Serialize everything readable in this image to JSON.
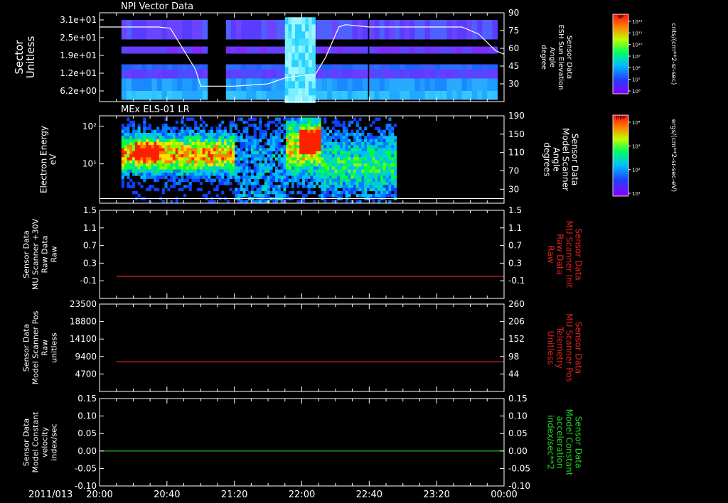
{
  "colors": {
    "background": "#000000",
    "frame": "#ffffff",
    "text": "#ffffff",
    "red_line": "#e02020",
    "green_line": "#22d322",
    "white_line": "#ffffff"
  },
  "x_axis": {
    "start_label": "2011/013",
    "tick_labels": [
      "20:00",
      "20:40",
      "21:20",
      "22:00",
      "22:40",
      "23:20",
      "00:00"
    ],
    "minutes": [
      0,
      40,
      80,
      120,
      160,
      200,
      240
    ],
    "range_minutes": [
      0,
      240
    ]
  },
  "chart_data": [
    {
      "id": "panel1",
      "type": "heatmap",
      "title": "NPI Vector Data",
      "ylabel_left": [
        "Sector",
        "Unitless"
      ],
      "ylabel_right": [
        "Sensor Data",
        "ESH Sun Elevation",
        "Angle",
        "degree"
      ],
      "left_ticks": [
        "3.1e+01",
        "2.5e+01",
        "1.9e+01",
        "1.2e+01",
        "6.2e+00"
      ],
      "right_ticks": [
        "90",
        "75",
        "60",
        "45",
        "30"
      ],
      "right_ylim": [
        15,
        90
      ],
      "colorbar": {
        "label": "NF",
        "units": "cnts/(cm**2-sr-sec)",
        "ticks": [
          "10¹²",
          "10¹¹",
          "10¹⁰",
          "10⁹",
          "10⁸",
          "10⁷",
          "10⁶"
        ]
      },
      "line_series": {
        "name": "Sun Elevation Angle",
        "color": "#ffffff",
        "x": [
          0,
          35,
          42,
          57,
          60,
          70,
          80,
          90,
          100,
          110,
          120,
          128,
          134,
          142,
          146,
          160,
          180,
          200,
          215,
          225,
          235,
          240
        ],
        "y": [
          78,
          78,
          77,
          42,
          28,
          28,
          28,
          29,
          30,
          35,
          37,
          38,
          52,
          78,
          80,
          78,
          78,
          78,
          78,
          72,
          58,
          55
        ]
      }
    },
    {
      "id": "panel2",
      "type": "heatmap",
      "title": "MEx ELS-01 LR",
      "ylabel_left": [
        "Electron Energy",
        "eV"
      ],
      "ylabel_right": [
        "Sensor Data",
        "Model Scanner",
        "Angle",
        "degrees"
      ],
      "left_ticks": [
        "10²",
        "10¹"
      ],
      "right_ticks": [
        "190",
        "150",
        "110",
        "70",
        "30"
      ],
      "right_ylim": [
        0,
        190
      ],
      "colorbar": {
        "label": "DEF",
        "units": "ergs/(cm**2-sr-sec-eV)",
        "ticks": [
          "10⁴",
          "10³",
          "10²",
          "10¹"
        ]
      },
      "line_series": {
        "name": "Model Scanner Angle",
        "color": "#ffffff",
        "x": [
          0,
          240
        ],
        "y": [
          10,
          10
        ]
      }
    },
    {
      "id": "panel3",
      "type": "line",
      "ylabel_left": [
        "Sensor Data",
        "MU Scanner +30V",
        "Raw Data",
        "Raw"
      ],
      "ylabel_right": [
        "Sensor Data",
        "MU Scanner Init",
        "Raw Data",
        "Raw"
      ],
      "left_ticks": [
        "1.5",
        "1.1",
        "0.7",
        "0.3",
        "-0.1"
      ],
      "right_ticks": [
        "1.5",
        "1.1",
        "0.7",
        "0.3",
        "-0.1"
      ],
      "ylim": [
        -0.5,
        1.5
      ],
      "series": [
        {
          "color": "#e02020",
          "x": [
            10,
            240
          ],
          "y": [
            0.0,
            0.0
          ]
        }
      ]
    },
    {
      "id": "panel4",
      "type": "line",
      "ylabel_left": [
        "Sensor Data",
        "Model Scanner Pos",
        "Raw",
        "unitless"
      ],
      "ylabel_right": [
        "Sensor Data",
        "MU Scanner Pos",
        "Telemetry",
        "Unitless"
      ],
      "left_ticks": [
        "23500",
        "18800",
        "14100",
        "9400",
        "4700"
      ],
      "right_ticks": [
        "260",
        "206",
        "152",
        "98",
        "44"
      ],
      "ylim": [
        0,
        23500
      ],
      "series": [
        {
          "color": "#e02020",
          "x": [
            10,
            240
          ],
          "y": [
            8000,
            8000
          ]
        }
      ]
    },
    {
      "id": "panel5",
      "type": "line",
      "ylabel_left": [
        "Sensor Data",
        "Model Constant",
        "velocity",
        "index/sec"
      ],
      "ylabel_right": [
        "Sensor Data",
        "Model Constant",
        "acceleration",
        "index/sec**2"
      ],
      "left_ticks": [
        "0.15",
        "0.10",
        "0.05",
        "0.00",
        "-0.05",
        "-0.10"
      ],
      "right_ticks": [
        "0.15",
        "0.10",
        "0.05",
        "0.00",
        "-0.05",
        "-0.10"
      ],
      "ylim": [
        -0.1,
        0.15
      ],
      "series": [
        {
          "color": "#22d322",
          "x": [
            0,
            240
          ],
          "y": [
            0,
            0
          ]
        }
      ]
    }
  ]
}
